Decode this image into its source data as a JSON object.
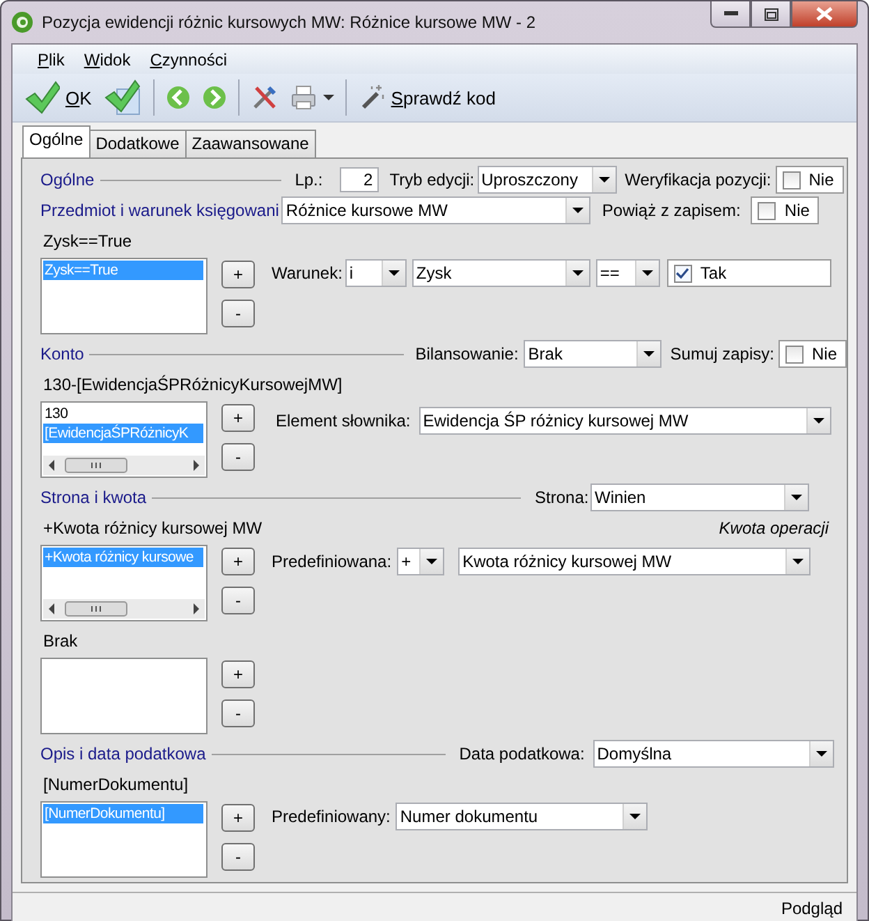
{
  "window": {
    "title": "Pozycja ewidencji różnic kursowych MW: Różnice kursowe MW - 2"
  },
  "menu": [
    {
      "label": "Plik"
    },
    {
      "label": "Widok"
    },
    {
      "label": "Czynności"
    }
  ],
  "toolbar": {
    "ok_label": "OK",
    "check_label": "Sprawdź kod"
  },
  "tabs": [
    {
      "label": "Ogólne",
      "selected": true
    },
    {
      "label": "Dodatkowe",
      "selected": false
    },
    {
      "label": "Zaawansowane",
      "selected": false
    }
  ],
  "general": {
    "title": "Ogólne",
    "lp_label": "Lp.:",
    "lp_value": "2",
    "mode_label": "Tryb edycji:",
    "mode_value": "Uproszczony",
    "verify_label": "Weryfikacja pozycji:",
    "verify": {
      "label": "Nie",
      "checked": false
    }
  },
  "subject": {
    "label": "Przedmiot i warunek księgowani",
    "value": "Różnice kursowe MW",
    "link_label": "Powiąż z zapisem:",
    "link": {
      "label": "Nie",
      "checked": false
    }
  },
  "condition": {
    "summary": "Zysk==True",
    "list": [
      {
        "text": "Zysk==True",
        "selected": true
      }
    ],
    "add": "+",
    "remove": "-",
    "label": "Warunek:",
    "join": "i",
    "field": "Zysk",
    "operator": "==",
    "value": {
      "label": "Tak",
      "checked": true
    }
  },
  "account": {
    "title": "Konto",
    "balance_label": "Bilansowanie:",
    "balance": "Brak",
    "sum_label": "Sumuj zapisy:",
    "sum": {
      "label": "Nie",
      "checked": false
    },
    "summary": "130-[EwidencjaŚPRóżnicyKursowejMW]",
    "list": [
      {
        "text": "130",
        "selected": false
      },
      {
        "text": "[EwidencjaŚPRóżnicyK",
        "selected": true
      }
    ],
    "add": "+",
    "remove": "-",
    "dict_label": "Element słownika:",
    "dict_value": "Ewidencja ŚP różnicy kursowej MW"
  },
  "amount": {
    "title": "Strona i kwota",
    "side_label": "Strona:",
    "side": "Winien",
    "summary": "+Kwota różnicy kursowej MW",
    "note": "Kwota operacji",
    "list": [
      {
        "text": "+Kwota różnicy kursowe",
        "selected": true
      }
    ],
    "add": "+",
    "remove": "-",
    "predef_label": "Predefiniowana:",
    "sign": "+",
    "predef_value": "Kwota różnicy kursowej MW"
  },
  "extra": {
    "summary": "Brak",
    "add": "+",
    "remove": "-"
  },
  "description": {
    "title": "Opis i data podatkowa",
    "tax_label": "Data podatkowa:",
    "tax_value": "Domyślna",
    "summary": "[NumerDokumentu]",
    "list": [
      {
        "text": "[NumerDokumentu]",
        "selected": true
      }
    ],
    "add": "+",
    "remove": "-",
    "predef_label": "Predefiniowany:",
    "predef_value": "Numer dokumentu"
  },
  "status_bar": {
    "text": "Podgląd"
  }
}
